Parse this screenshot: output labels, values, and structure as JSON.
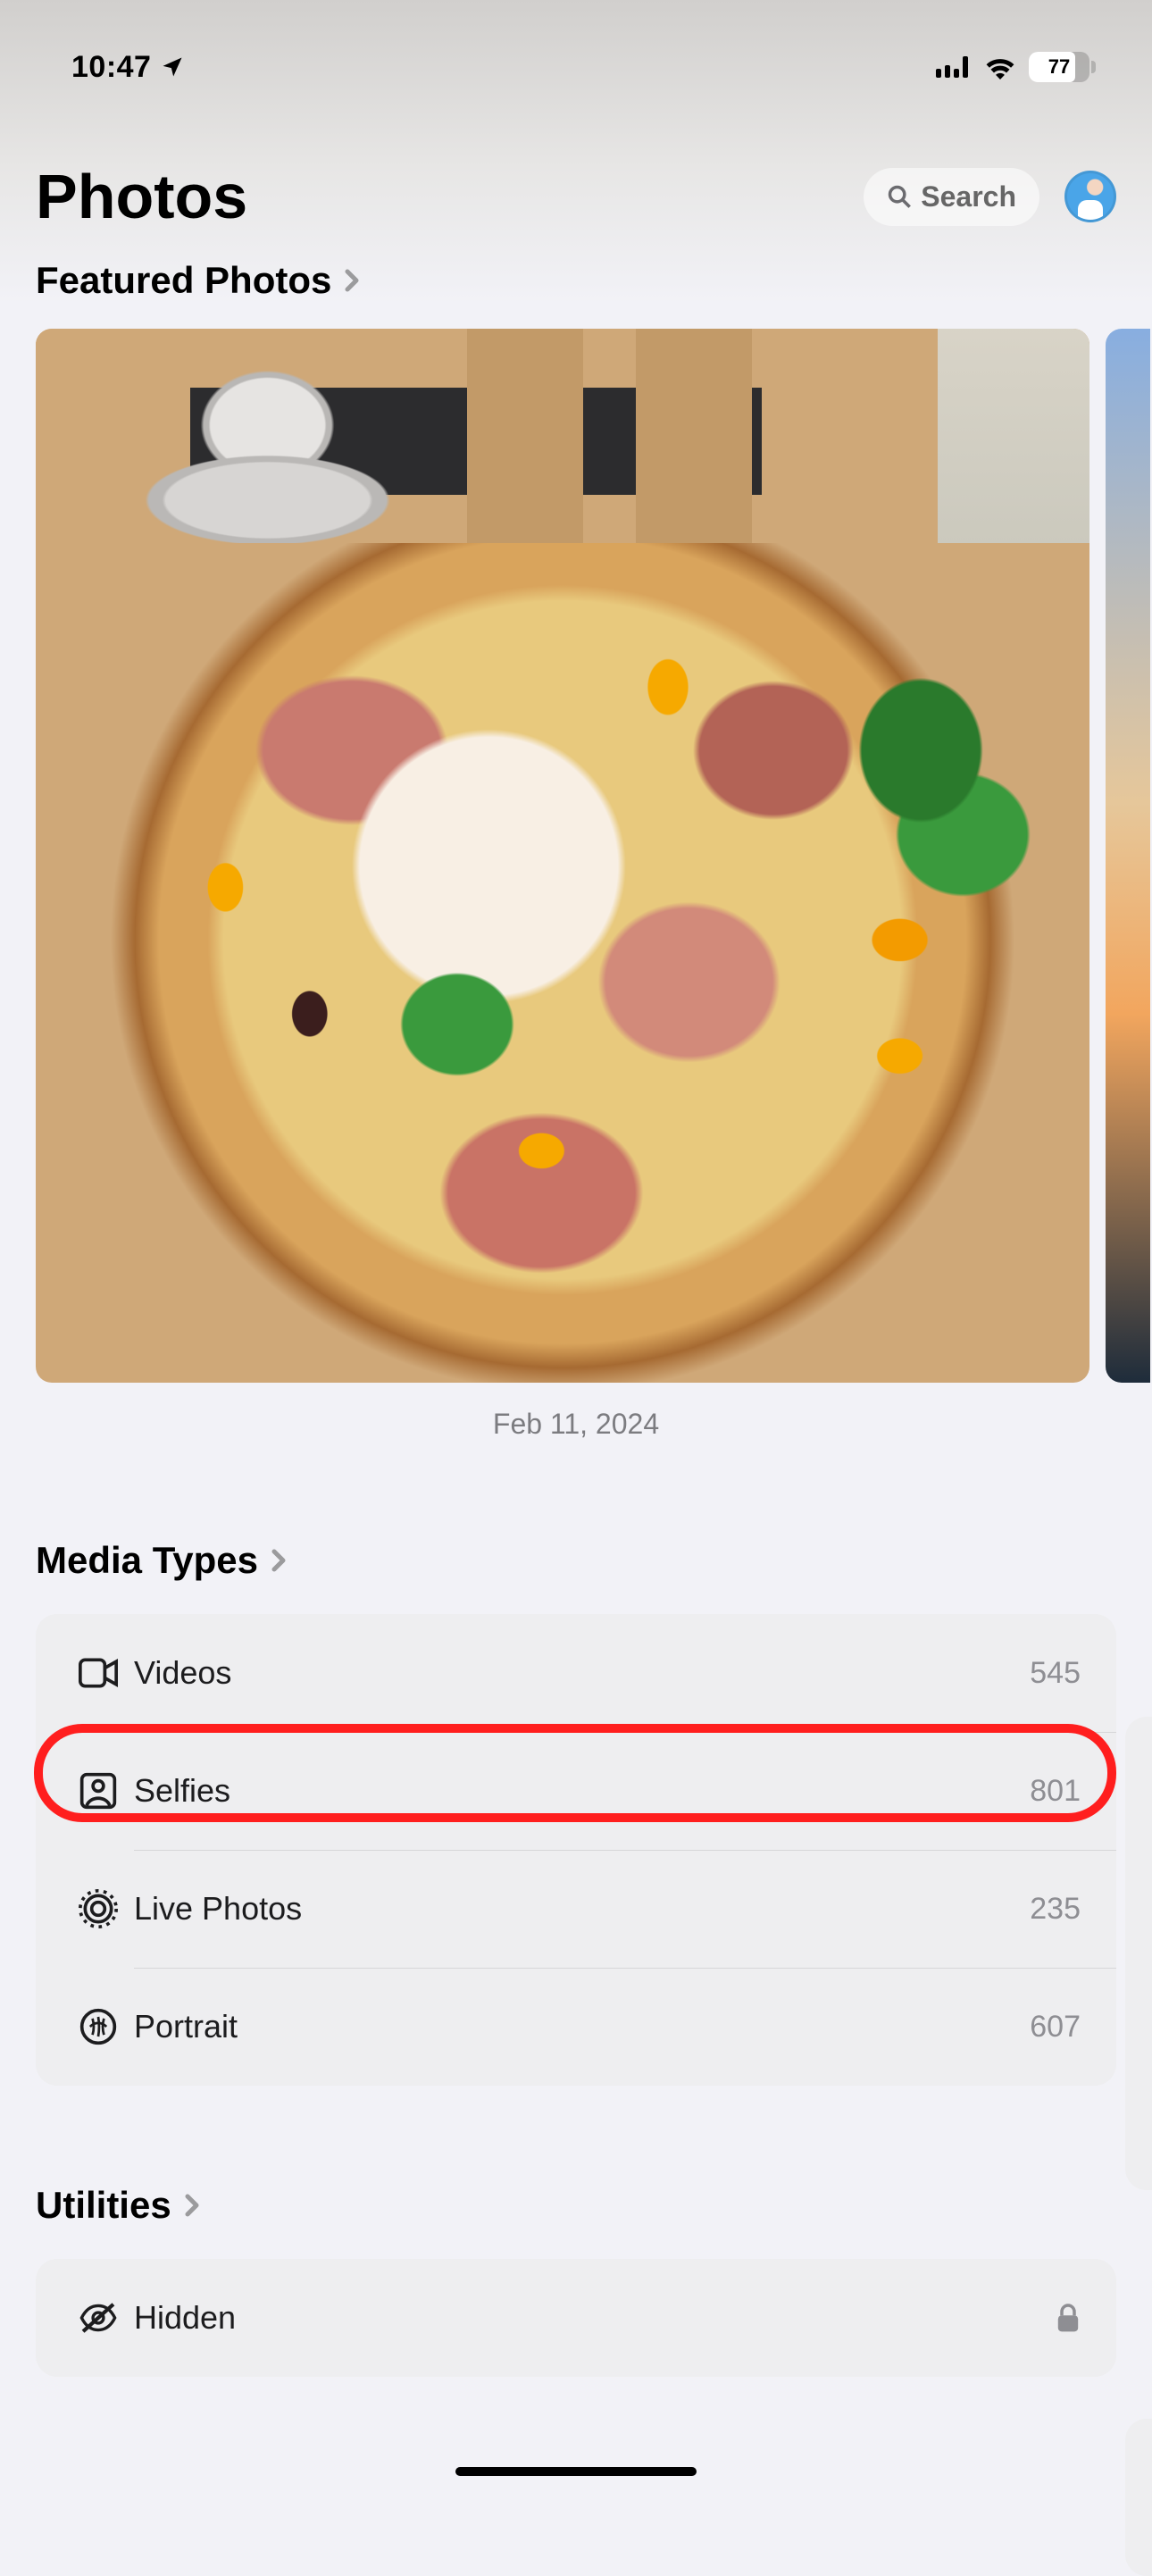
{
  "status": {
    "time": "10:47",
    "battery_pct": "77"
  },
  "page": {
    "title": "Photos"
  },
  "search": {
    "label": "Search"
  },
  "sections": {
    "featured": {
      "title": "Featured Photos",
      "date_caption": "Feb 11, 2024"
    },
    "media_types": {
      "title": "Media Types",
      "items": [
        {
          "icon": "video",
          "label": "Videos",
          "count": "545"
        },
        {
          "icon": "selfie",
          "label": "Selfies",
          "count": "801"
        },
        {
          "icon": "live",
          "label": "Live Photos",
          "count": "235"
        },
        {
          "icon": "portrait",
          "label": "Portrait",
          "count": "607"
        }
      ]
    },
    "utilities": {
      "title": "Utilities",
      "items": [
        {
          "icon": "hidden",
          "label": "Hidden",
          "locked": true
        }
      ]
    }
  }
}
